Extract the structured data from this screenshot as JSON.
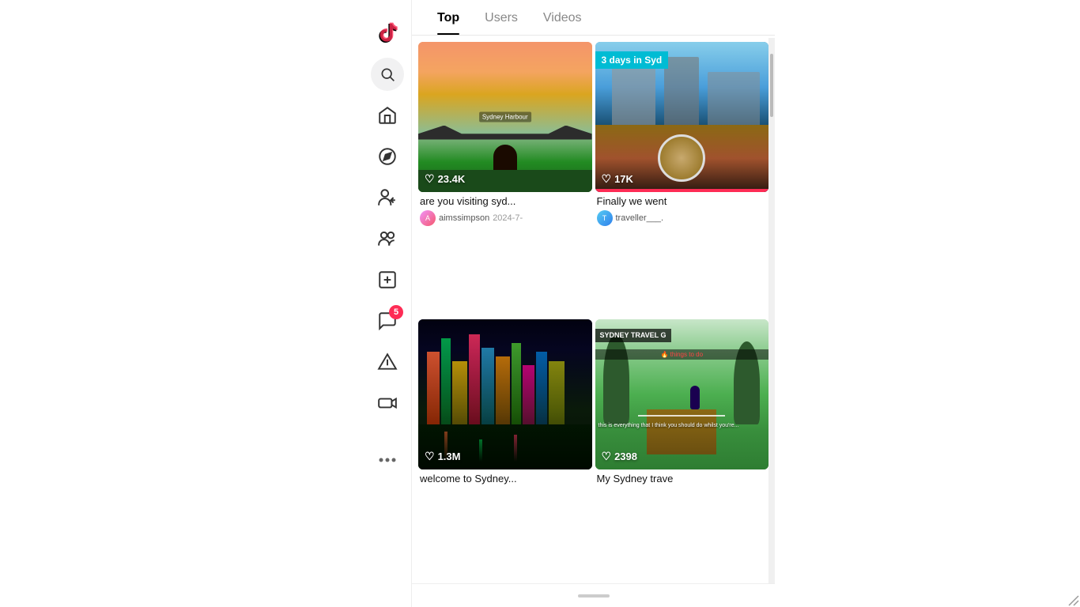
{
  "app": {
    "name": "TikTok"
  },
  "tabs": [
    {
      "id": "top",
      "label": "Top",
      "active": true
    },
    {
      "id": "users",
      "label": "Users",
      "active": false
    },
    {
      "id": "videos",
      "label": "Videos",
      "active": false
    }
  ],
  "videos": [
    {
      "id": "v1",
      "title": "are you visiting syd...",
      "author": "aimssimpson",
      "date": "2024-7-",
      "likes": "23.4K",
      "thumb_type": "sydney_sunset",
      "overlay": null
    },
    {
      "id": "v2",
      "title": "Finally we went",
      "author": "traveller___.",
      "date": "",
      "likes": "17K",
      "thumb_type": "sydney_aerial",
      "overlay": "3 days in Syd"
    },
    {
      "id": "v3",
      "title": "welcome to Sydney...",
      "author": "",
      "date": "",
      "likes": "1.3M",
      "thumb_type": "city_lights",
      "overlay": null
    },
    {
      "id": "v4",
      "title": "My Sydney trave",
      "author": "",
      "date": "",
      "likes": "2398",
      "thumb_type": "forest_path",
      "overlay": "SYDNEY TRAVEL G"
    }
  ],
  "sidebar": {
    "icons": [
      {
        "id": "home",
        "label": "Home"
      },
      {
        "id": "search",
        "label": "Search"
      },
      {
        "id": "following",
        "label": "Following"
      },
      {
        "id": "friends",
        "label": "Friends"
      },
      {
        "id": "add",
        "label": "Add"
      },
      {
        "id": "messages",
        "label": "Messages",
        "badge": "5"
      },
      {
        "id": "inbox",
        "label": "Inbox"
      },
      {
        "id": "live",
        "label": "Live"
      }
    ]
  },
  "bottom": {
    "handle_label": "drag handle"
  }
}
